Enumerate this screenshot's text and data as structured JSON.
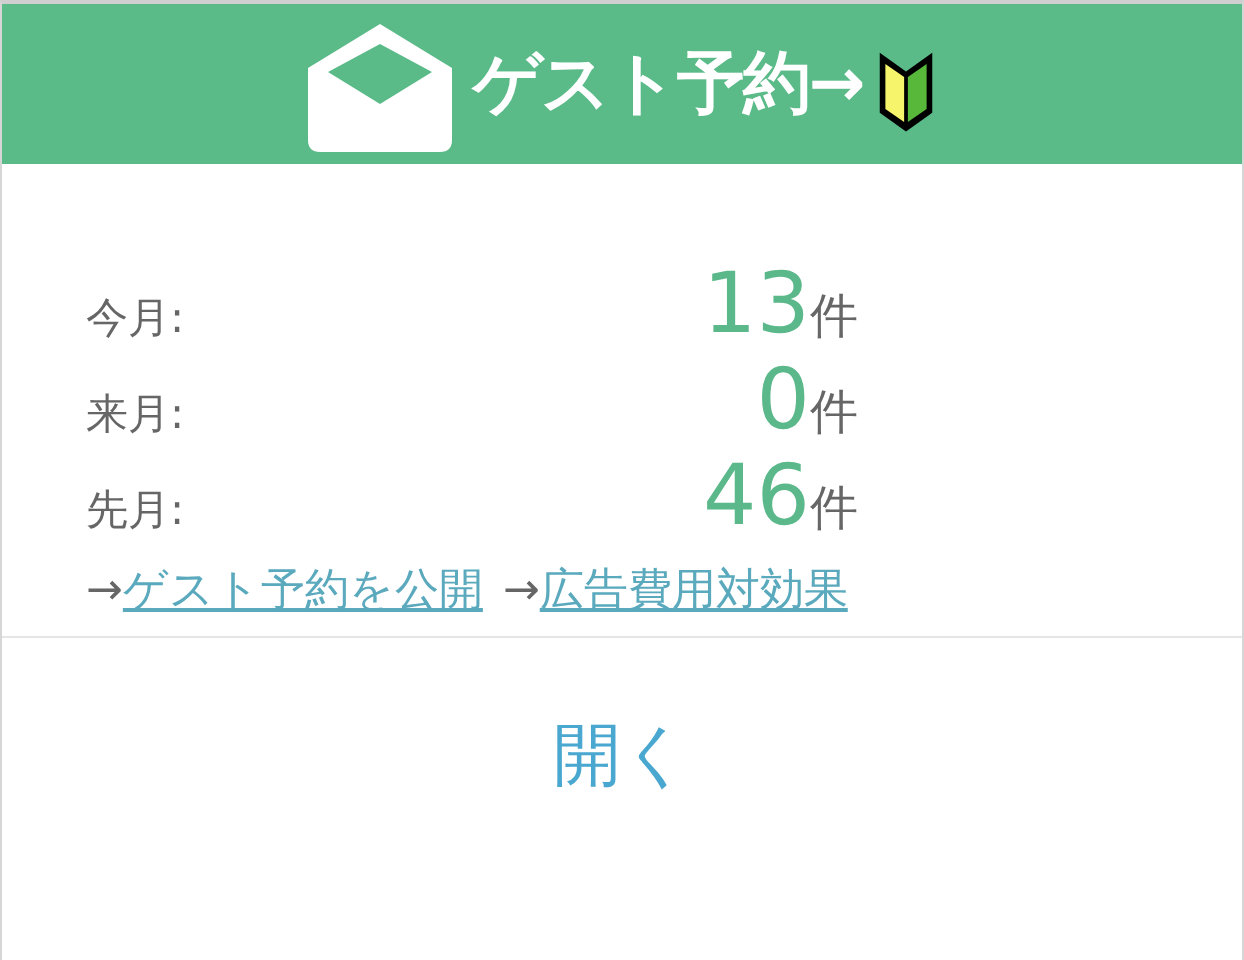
{
  "header": {
    "title": "ゲスト予約→"
  },
  "stats": [
    {
      "label": "今月:",
      "value": "13",
      "unit": "件"
    },
    {
      "label": "来月:",
      "value": "0",
      "unit": "件"
    },
    {
      "label": "先月:",
      "value": "46",
      "unit": "件"
    }
  ],
  "links": [
    {
      "prefix": "→",
      "label": "ゲスト予約を公開"
    },
    {
      "prefix": "→",
      "label": "広告費用対効果"
    }
  ],
  "button": {
    "label": "開く"
  }
}
